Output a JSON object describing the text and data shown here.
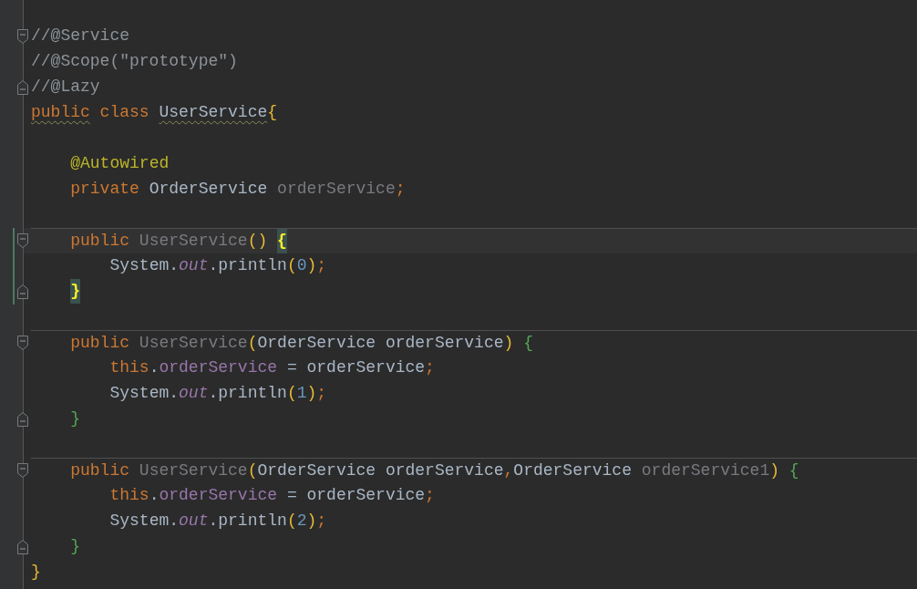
{
  "editor": {
    "lines": [
      {
        "kind": "code",
        "fold_start": true,
        "tokens": [
          {
            "text": "//@Service",
            "kind": "comment"
          }
        ]
      },
      {
        "kind": "code",
        "tokens": [
          {
            "text": "//@Scope(\"prototype\")",
            "kind": "comment"
          }
        ]
      },
      {
        "kind": "code",
        "fold_end": true,
        "tokens": [
          {
            "text": "//@Lazy",
            "kind": "comment"
          }
        ]
      },
      {
        "kind": "code",
        "tokens": [
          {
            "text": "public",
            "kind": "keyword",
            "warning": true
          },
          {
            "text": " class ",
            "kind": "keyword"
          },
          {
            "text": "UserService",
            "kind": "plain",
            "warning": true
          },
          {
            "text": "{",
            "kind": "bracket",
            "color": "#e8ba36"
          }
        ]
      },
      {
        "kind": "blank"
      },
      {
        "kind": "code",
        "tokens": [
          {
            "text": "    @Autowired",
            "kind": "annotation"
          }
        ]
      },
      {
        "kind": "code",
        "tokens": [
          {
            "text": "    private ",
            "kind": "keyword"
          },
          {
            "text": "OrderService ",
            "kind": "plain"
          },
          {
            "text": "orderService",
            "kind": "unused"
          },
          {
            "text": ";",
            "kind": "punct"
          }
        ]
      },
      {
        "kind": "blank"
      },
      {
        "kind": "code",
        "fold_start": true,
        "separator": true,
        "current": true,
        "changed": true,
        "tokens": [
          {
            "text": "    public ",
            "kind": "keyword"
          },
          {
            "text": "UserService",
            "kind": "unused"
          },
          {
            "text": "() ",
            "kind": "bracket",
            "color": "#e8ba36"
          },
          {
            "text": "{",
            "kind": "bracket",
            "matched": true
          }
        ]
      },
      {
        "kind": "code",
        "changed": true,
        "tokens": [
          {
            "text": "        System.",
            "kind": "plain"
          },
          {
            "text": "out",
            "kind": "static"
          },
          {
            "text": ".println",
            "kind": "plain"
          },
          {
            "text": "(",
            "kind": "bracket",
            "color": "#e8ba36"
          },
          {
            "text": "0",
            "kind": "number"
          },
          {
            "text": ")",
            "kind": "bracket",
            "color": "#e8ba36"
          },
          {
            "text": ";",
            "kind": "punct"
          }
        ]
      },
      {
        "kind": "code",
        "fold_end": true,
        "changed": true,
        "tokens": [
          {
            "text": "    }",
            "kind": "bracket",
            "matched": true
          }
        ]
      },
      {
        "kind": "blank"
      },
      {
        "kind": "code",
        "fold_start": true,
        "separator": true,
        "tokens": [
          {
            "text": "    public ",
            "kind": "keyword"
          },
          {
            "text": "UserService",
            "kind": "unused"
          },
          {
            "text": "(",
            "kind": "bracket",
            "color": "#e8ba36"
          },
          {
            "text": "OrderService orderService",
            "kind": "plain"
          },
          {
            "text": ")",
            "kind": "bracket",
            "color": "#e8ba36"
          },
          {
            "text": " {",
            "kind": "bracket",
            "color": "#54a857"
          }
        ]
      },
      {
        "kind": "code",
        "tokens": [
          {
            "text": "        this",
            "kind": "keyword"
          },
          {
            "text": ".",
            "kind": "plain"
          },
          {
            "text": "orderService",
            "kind": "field"
          },
          {
            "text": " = orderService",
            "kind": "plain"
          },
          {
            "text": ";",
            "kind": "punct"
          }
        ]
      },
      {
        "kind": "code",
        "tokens": [
          {
            "text": "        System.",
            "kind": "plain"
          },
          {
            "text": "out",
            "kind": "static"
          },
          {
            "text": ".println",
            "kind": "plain"
          },
          {
            "text": "(",
            "kind": "bracket",
            "color": "#e8ba36"
          },
          {
            "text": "1",
            "kind": "number"
          },
          {
            "text": ")",
            "kind": "bracket",
            "color": "#e8ba36"
          },
          {
            "text": ";",
            "kind": "punct"
          }
        ]
      },
      {
        "kind": "code",
        "fold_end": true,
        "tokens": [
          {
            "text": "    }",
            "kind": "bracket",
            "color": "#54a857"
          }
        ]
      },
      {
        "kind": "blank"
      },
      {
        "kind": "code",
        "fold_start": true,
        "separator": true,
        "tokens": [
          {
            "text": "    public ",
            "kind": "keyword"
          },
          {
            "text": "UserService",
            "kind": "unused"
          },
          {
            "text": "(",
            "kind": "bracket",
            "color": "#e8ba36"
          },
          {
            "text": "OrderService orderService",
            "kind": "plain"
          },
          {
            "text": ",",
            "kind": "punct"
          },
          {
            "text": "OrderService ",
            "kind": "plain"
          },
          {
            "text": "orderService1",
            "kind": "unused"
          },
          {
            "text": ")",
            "kind": "bracket",
            "color": "#e8ba36"
          },
          {
            "text": " {",
            "kind": "bracket",
            "color": "#54a857"
          }
        ]
      },
      {
        "kind": "code",
        "tokens": [
          {
            "text": "        this",
            "kind": "keyword"
          },
          {
            "text": ".",
            "kind": "plain"
          },
          {
            "text": "orderService",
            "kind": "field"
          },
          {
            "text": " = orderService",
            "kind": "plain"
          },
          {
            "text": ";",
            "kind": "punct"
          }
        ]
      },
      {
        "kind": "code",
        "tokens": [
          {
            "text": "        System.",
            "kind": "plain"
          },
          {
            "text": "out",
            "kind": "static"
          },
          {
            "text": ".println",
            "kind": "plain"
          },
          {
            "text": "(",
            "kind": "bracket",
            "color": "#e8ba36"
          },
          {
            "text": "2",
            "kind": "number"
          },
          {
            "text": ")",
            "kind": "bracket",
            "color": "#e8ba36"
          },
          {
            "text": ";",
            "kind": "punct"
          }
        ]
      },
      {
        "kind": "code",
        "fold_end": true,
        "tokens": [
          {
            "text": "    }",
            "kind": "bracket",
            "color": "#54a857"
          }
        ]
      },
      {
        "kind": "code",
        "tokens": [
          {
            "text": "}",
            "kind": "bracket",
            "color": "#e8ba36"
          }
        ]
      }
    ]
  }
}
